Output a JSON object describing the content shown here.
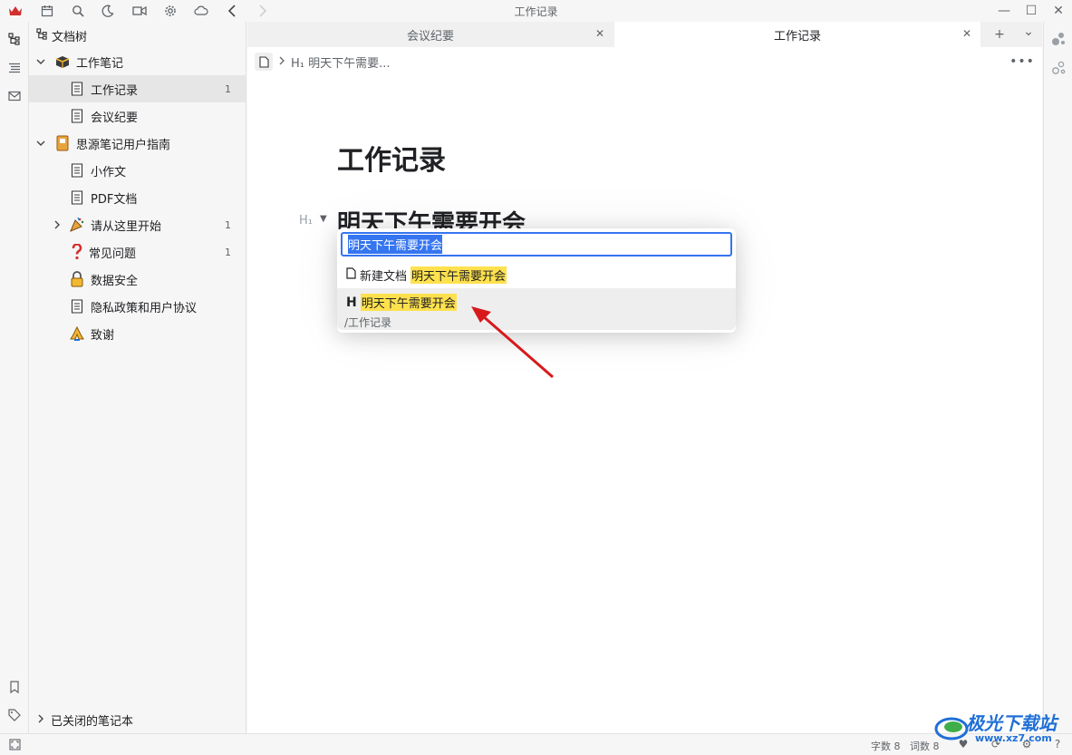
{
  "window": {
    "title": "工作记录"
  },
  "toolbar": {
    "icons": [
      "app-logo-icon",
      "calendar-icon",
      "search-icon",
      "moon-icon",
      "video-icon",
      "gear-icon",
      "cloud-icon",
      "back-icon",
      "forward-icon"
    ],
    "window_buttons": {
      "minimize": "—",
      "maximize": "☐",
      "close": "✕"
    }
  },
  "sidebar": {
    "header": "文档树",
    "items": [
      {
        "label": "工作笔记",
        "count": "",
        "level": 0
      },
      {
        "label": "工作记录",
        "count": "1",
        "level": 1
      },
      {
        "label": "会议纪要",
        "count": "",
        "level": 1
      },
      {
        "label": "思源笔记用户指南",
        "count": "",
        "level": 0
      },
      {
        "label": "小作文",
        "count": "",
        "level": 1
      },
      {
        "label": "PDF文档",
        "count": "",
        "level": 1
      },
      {
        "label": "请从这里开始",
        "count": "1",
        "level": 1
      },
      {
        "label": "常见问题",
        "count": "1",
        "level": 1
      },
      {
        "label": "数据安全",
        "count": "",
        "level": 1
      },
      {
        "label": "隐私政策和用户协议",
        "count": "",
        "level": 1
      },
      {
        "label": "致谢",
        "count": "",
        "level": 1
      }
    ],
    "footer": "已关闭的笔记本"
  },
  "tabs": [
    {
      "label": "会议纪要",
      "active": false
    },
    {
      "label": "工作记录",
      "active": true
    }
  ],
  "tab_tools": {
    "add": "+",
    "dropdown": "⌄"
  },
  "editor": {
    "breadcrumb_heading": "H₁ 明天下午需要...",
    "title": "工作记录",
    "h1_marker": "H₁",
    "heading_text": "明天下午需要开会",
    "more": "•••"
  },
  "popup": {
    "input_value": "明天下午需要开会",
    "new_doc_label": "新建文档",
    "new_doc_highlight": "明天下午需要开会",
    "result_marker": "H",
    "result_text": "明天下午需要开会",
    "result_path": "/工作记录"
  },
  "statusbar": {
    "char_count": "字数 8",
    "word_count": "词数 8"
  },
  "watermark": {
    "text": "极光下载站",
    "sub": "www.xz7.com"
  },
  "colors": {
    "accent": "#3575f0",
    "highlight": "#ffe14d",
    "annotation_arrow": "#d7191c"
  }
}
